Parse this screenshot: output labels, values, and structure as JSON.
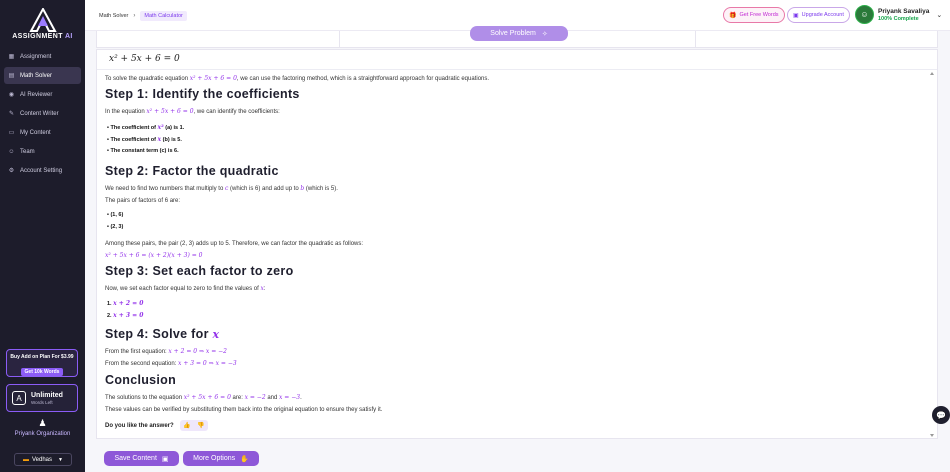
{
  "sidebar": {
    "logo_text_a": "ASSIGNMENT",
    "logo_text_b": "AI",
    "items": [
      {
        "label": "Assignment",
        "icon": "grid-icon"
      },
      {
        "label": "Math Solver",
        "icon": "calculator-icon"
      },
      {
        "label": "AI Reviewer",
        "icon": "robot-icon"
      },
      {
        "label": "Content Writer",
        "icon": "pen-icon"
      },
      {
        "label": "My Content",
        "icon": "folder-icon"
      },
      {
        "label": "Team",
        "icon": "team-icon"
      },
      {
        "label": "Account Setting",
        "icon": "gear-icon"
      }
    ],
    "promo": {
      "title": "Buy Add on Plan For $3.99",
      "button": "Get 10k Words"
    },
    "plan": {
      "title": "Unlimited",
      "subtitle": "Words Left"
    },
    "organization": "Priyank Organization",
    "language": "Vedhas"
  },
  "header": {
    "breadcrumb": [
      "Math Solver",
      "Math Calculator"
    ],
    "free_words": "Get Free Words",
    "upgrade": "Upgrade Account",
    "user_name": "Priyank Savaliya",
    "user_status": "100% Complete"
  },
  "solve_button": "Solve Problem",
  "equation_input": "x² + 5x + 6 = 0",
  "solution": {
    "intro_a": "To solve the quadratic equation ",
    "intro_eq": "x² + 5x + 6 = 0",
    "intro_b": ", we can use the factoring method, which is a straightforward approach for quadratic equations.",
    "step1_title": "Step 1: Identify the coefficients",
    "step1_text_a": "In the equation ",
    "step1_text_eq": "x² + 5x + 6 = 0",
    "step1_text_b": ", we can identify the coefficients:",
    "coef_a_a": "The coefficient of ",
    "coef_a_m": "x²",
    "coef_a_b": " (a) is 1.",
    "coef_b_a": "The coefficient of ",
    "coef_b_m": "x",
    "coef_b_b": " (b) is 5.",
    "coef_c": "The constant term (c) is 6.",
    "step2_title": "Step 2: Factor the quadratic",
    "step2_text_a": "We need to find two numbers that multiply to ",
    "step2_text_m1": "c",
    "step2_text_b": " (which is 6) and add up to ",
    "step2_text_m2": "b",
    "step2_text_c": " (which is 5).",
    "pairs_text": "The pairs of factors of 6 are:",
    "pairs": [
      "(1, 6)",
      "(2, 3)"
    ],
    "among_text": "Among these pairs, the pair (2, 3) adds up to 5. Therefore, we can factor the quadratic as follows:",
    "factored_eq": "x² + 5x + 6 = (x + 2)(x + 3) = 0",
    "step3_title": "Step 3: Set each factor to zero",
    "step3_text_a": "Now, we set each factor equal to zero to find the values of ",
    "step3_text_m": "x",
    "step3_text_b": ":",
    "factors": [
      "x + 2 = 0",
      "x + 3 = 0"
    ],
    "step4_title_a": "Step 4: Solve for ",
    "step4_title_m": "x",
    "step4_line1_a": "From the first equation: ",
    "step4_line1_m": "x + 2 = 0 ⇒ x = −2",
    "step4_line2_a": "From the second equation: ",
    "step4_line2_m": "x + 3 = 0 ⇒ x = −3",
    "conclusion_title": "Conclusion",
    "concl_a": "The solutions to the equation ",
    "concl_eq": "x² + 5x + 6 = 0",
    "concl_b": " are: ",
    "concl_m1": "x = −2",
    "concl_c": " and ",
    "concl_m2": "x = −3",
    "concl_d": ".",
    "verify_text": "These values can be verified by substituting them back into the original equation to ensure they satisfy it.",
    "feedback_q": "Do you like the answer?"
  },
  "actions": {
    "save": "Save Content",
    "more": "More Options"
  }
}
